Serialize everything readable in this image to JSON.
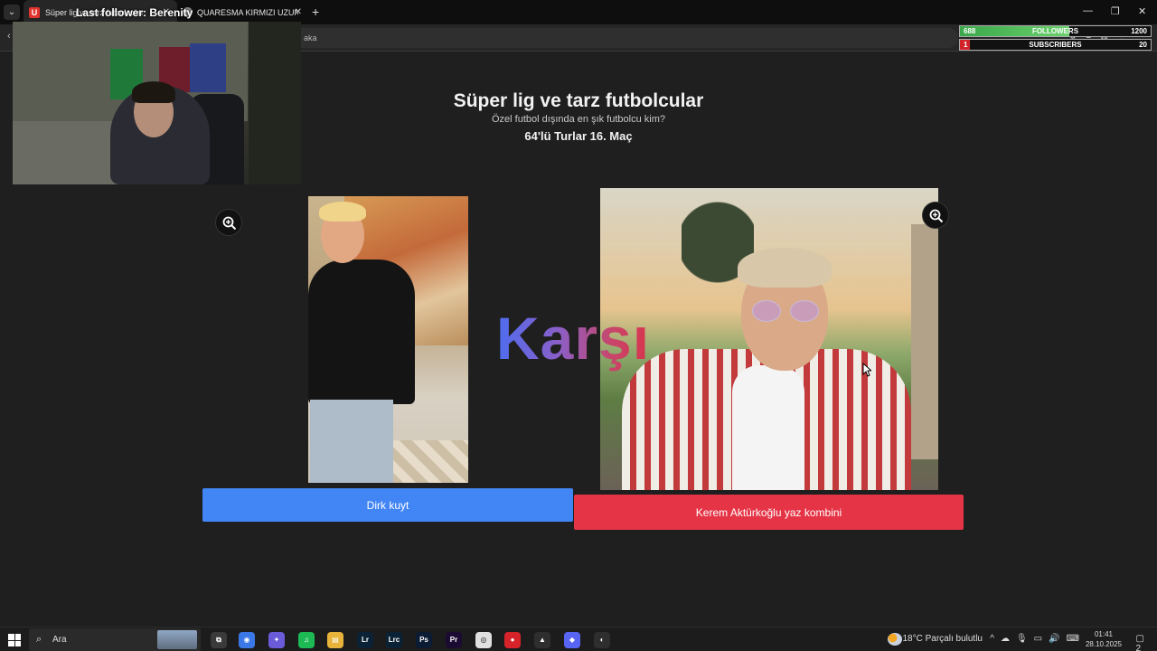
{
  "browser": {
    "tabs": [
      {
        "label": "Süper lig ve tarz futbolcular",
        "active": true
      },
      {
        "label": "QUARESMA KIRMIZI UZUN GÖ…",
        "active": false
      }
    ],
    "address_partial": "aka"
  },
  "overlay": {
    "last_follower": "Last follower: Berenity",
    "followers": {
      "current": "688",
      "label": "FOLLOWERS",
      "goal": "1200",
      "progress": 0.573
    },
    "subscribers": {
      "current": "1",
      "label": "SUBSCRIBERS",
      "goal": "20",
      "progress": 0.05
    }
  },
  "page": {
    "title": "Süper lig ve tarz futbolcular",
    "subtitle": "Özel futbol dışında en şık futbolcu kim?",
    "round": "64'lü Turlar 16. Maç",
    "versus": "Karşı",
    "left_choice": "Dirk kuyt",
    "right_choice": "Kerem Aktürkoğlu yaz kombini"
  },
  "taskbar": {
    "search_placeholder": "Ara",
    "weather": "18°C  Parçalı bulutlu",
    "time": "01:41",
    "date": "28.10.2025",
    "notification_count": "2",
    "apps": [
      {
        "id": "task-view",
        "label": "⧉",
        "color": "#3a3a3a"
      },
      {
        "id": "chrome",
        "label": "◉",
        "color": "#3b78e7"
      },
      {
        "id": "copilot",
        "label": "✦",
        "color": "#6a5bd8"
      },
      {
        "id": "spotify",
        "label": "♫",
        "color": "#1db954"
      },
      {
        "id": "explorer",
        "label": "▤",
        "color": "#e8b33a"
      },
      {
        "id": "lightroom",
        "label": "Lr",
        "color": "#0b2236"
      },
      {
        "id": "lightroom-classic",
        "label": "Lrc",
        "color": "#0b2236"
      },
      {
        "id": "photoshop",
        "label": "Ps",
        "color": "#0b1b33"
      },
      {
        "id": "premiere",
        "label": "Pr",
        "color": "#1b0b33"
      },
      {
        "id": "obs",
        "label": "◎",
        "color": "#e0e0e0"
      },
      {
        "id": "recorder",
        "label": "●",
        "color": "#d6232a"
      },
      {
        "id": "nvidia",
        "label": "▲",
        "color": "#2e2e2e"
      },
      {
        "id": "discord",
        "label": "◆",
        "color": "#5865f2"
      },
      {
        "id": "clock-app",
        "label": "◐",
        "color": "#2e2e2e"
      }
    ]
  }
}
